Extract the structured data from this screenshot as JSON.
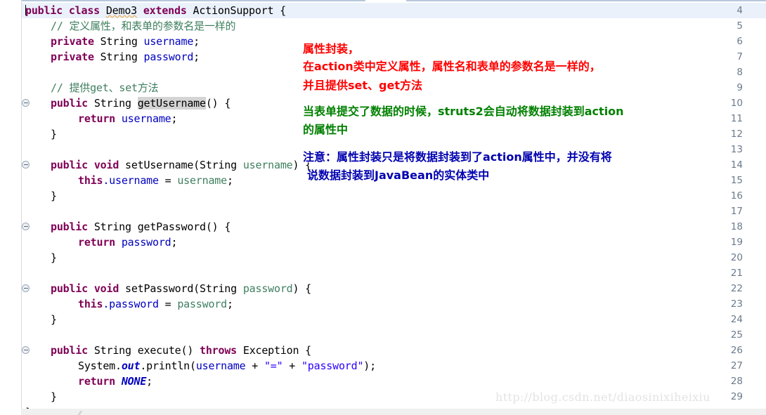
{
  "editor": {
    "language": "java",
    "class_name": "Demo3",
    "current_line": 4,
    "colors": {
      "keyword": "#7f0055",
      "field": "#0000c0",
      "string": "#2a00ff",
      "comment": "#3f7f5f",
      "static_field": "#0000c0",
      "current_line_bg": "#eaf1fb",
      "occurrence_highlight": "#d4d4d4",
      "gutter_text": "#6a7a8c"
    },
    "line_numbers": [
      "4",
      "5",
      "6",
      "7",
      "8",
      "9",
      "10",
      "11",
      "12",
      "13",
      "14",
      "15",
      "16",
      "17",
      "18",
      "19",
      "20",
      "21",
      "22",
      "23",
      "24",
      "25",
      "26",
      "27",
      "28",
      "29"
    ],
    "fold_lines": [
      "10",
      "14",
      "18",
      "22",
      "26"
    ],
    "lines": [
      {
        "n": "4",
        "text": "public class Demo3 extends ActionSupport {"
      },
      {
        "n": "5",
        "text": "    // 定义属性，和表单的参数名是一样的"
      },
      {
        "n": "6",
        "text": "    private String username;"
      },
      {
        "n": "7",
        "text": "    private String password;"
      },
      {
        "n": "8",
        "text": ""
      },
      {
        "n": "9",
        "text": "    // 提供get、set方法"
      },
      {
        "n": "10",
        "text": "    public String getUsername() {"
      },
      {
        "n": "11",
        "text": "        return username;"
      },
      {
        "n": "12",
        "text": "    }"
      },
      {
        "n": "13",
        "text": ""
      },
      {
        "n": "14",
        "text": "    public void setUsername(String username) {"
      },
      {
        "n": "15",
        "text": "        this.username = username;"
      },
      {
        "n": "16",
        "text": "    }"
      },
      {
        "n": "17",
        "text": ""
      },
      {
        "n": "18",
        "text": "    public String getPassword() {"
      },
      {
        "n": "19",
        "text": "        return password;"
      },
      {
        "n": "20",
        "text": "    }"
      },
      {
        "n": "21",
        "text": ""
      },
      {
        "n": "22",
        "text": "    public void setPassword(String password) {"
      },
      {
        "n": "23",
        "text": "        this.password = password;"
      },
      {
        "n": "24",
        "text": "    }"
      },
      {
        "n": "25",
        "text": ""
      },
      {
        "n": "26",
        "text": "    public String execute() throws Exception {"
      },
      {
        "n": "27",
        "text": "        System.out.println(username + \"=\" + \"password\");"
      },
      {
        "n": "28",
        "text": "        return NONE;"
      },
      {
        "n": "29",
        "text": "    }"
      }
    ],
    "tokens": {
      "l4_public": "public",
      "l4_class": "class",
      "l4_name": "Demo3",
      "l4_extends": "extends",
      "l4_super": "ActionSupport",
      "l4_brace": "{",
      "l5_comment": "// 定义属性，和表单的参数名是一样的",
      "l6_private": "private",
      "l6_string": "String",
      "l6_field": "username",
      "l6_semi": ";",
      "l7_private": "private",
      "l7_string": "String",
      "l7_field": "password",
      "l7_semi": ";",
      "l9_comment": "// 提供get、set方法",
      "l10_public": "public",
      "l10_type": "String",
      "l10_method": "getUsername",
      "l10_tail": "() {",
      "l11_return": "return",
      "l11_field": "username",
      "l11_semi": ";",
      "l12_brace": "}",
      "l14_public": "public",
      "l14_void": "void",
      "l14_method": "setUsername(String",
      "l14_param": "username",
      "l14_tail": ") {",
      "l15_this": "this",
      "l15_dot_field": ".username",
      "l15_eq": " = ",
      "l15_param": "username",
      "l15_semi": ";",
      "l16_brace": "}",
      "l18_public": "public",
      "l18_type": "String",
      "l18_method": "getPassword() {",
      "l19_return": "return",
      "l19_field": "password",
      "l19_semi": ";",
      "l20_brace": "}",
      "l22_public": "public",
      "l22_void": "void",
      "l22_method": "setPassword(String",
      "l22_param": "password",
      "l22_tail": ") {",
      "l23_this": "this",
      "l23_dot_field": ".password",
      "l23_eq": " = ",
      "l23_param": "password",
      "l23_semi": ";",
      "l24_brace": "}",
      "l26_public": "public",
      "l26_type": "String",
      "l26_method": "execute()",
      "l26_throws": "throws",
      "l26_ex": "Exception {",
      "l27_system": "System.",
      "l27_out": "out",
      "l27_println": ".println(",
      "l27_field": "username",
      "l27_plus1": " + ",
      "l27_str1": "\"=\"",
      "l27_plus2": " + ",
      "l27_str2": "\"password\"",
      "l27_tail": ");",
      "l28_return": "return",
      "l28_none": "NONE",
      "l28_semi": ";",
      "l29_brace": "}"
    }
  },
  "annotations": {
    "red": {
      "color": "#ff0000",
      "lines": [
        "属性封装，",
        "在action类中定义属性，属性名和表单的参数名是一样的，",
        "并且提供set、get方法"
      ]
    },
    "green": {
      "color": "#008000",
      "lines": [
        "当表单提交了数据的时候，struts2会自动将数据封装到action",
        "的属性中"
      ]
    },
    "blue": {
      "color": "#0000b0",
      "lines": [
        "注意：属性封装只是将数据封装到了action属性中，并没有将",
        "说数据封装到JavaBean的实体类中"
      ]
    }
  },
  "watermark": {
    "text": "http://blog.csdn.net/diaosinixiheixiu"
  }
}
